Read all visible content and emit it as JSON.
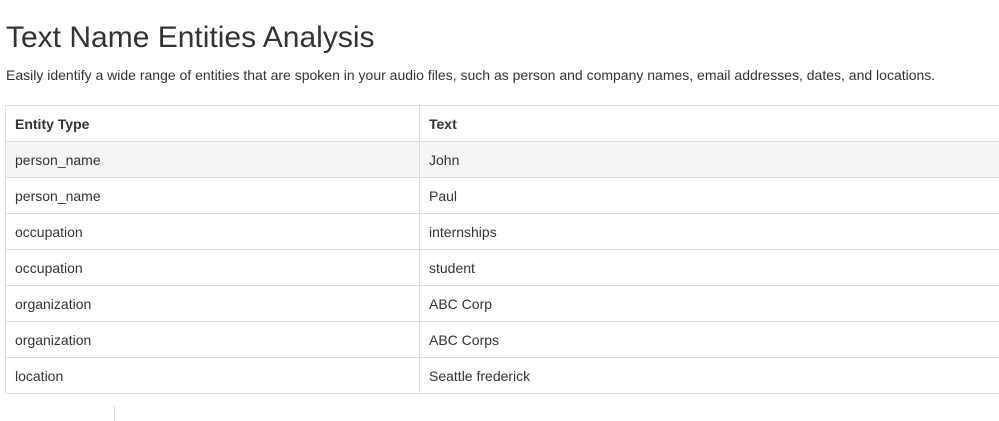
{
  "page": {
    "title": "Text Name Entities Analysis",
    "description": "Easily identify a wide range of entities that are spoken in your audio files, such as person and company names, email addresses, dates, and locations."
  },
  "table": {
    "headers": [
      "Entity Type",
      "Text"
    ],
    "rows": [
      {
        "entity_type": "person_name",
        "text": "John"
      },
      {
        "entity_type": "person_name",
        "text": "Paul"
      },
      {
        "entity_type": "occupation",
        "text": "internships"
      },
      {
        "entity_type": "occupation",
        "text": "student"
      },
      {
        "entity_type": "organization",
        "text": "ABC Corp"
      },
      {
        "entity_type": "organization",
        "text": "ABC Corps"
      },
      {
        "entity_type": "location",
        "text": "Seattle frederick"
      }
    ],
    "highlighted_row_bg": "#f5f5f5",
    "border_color": "#dddddd"
  }
}
